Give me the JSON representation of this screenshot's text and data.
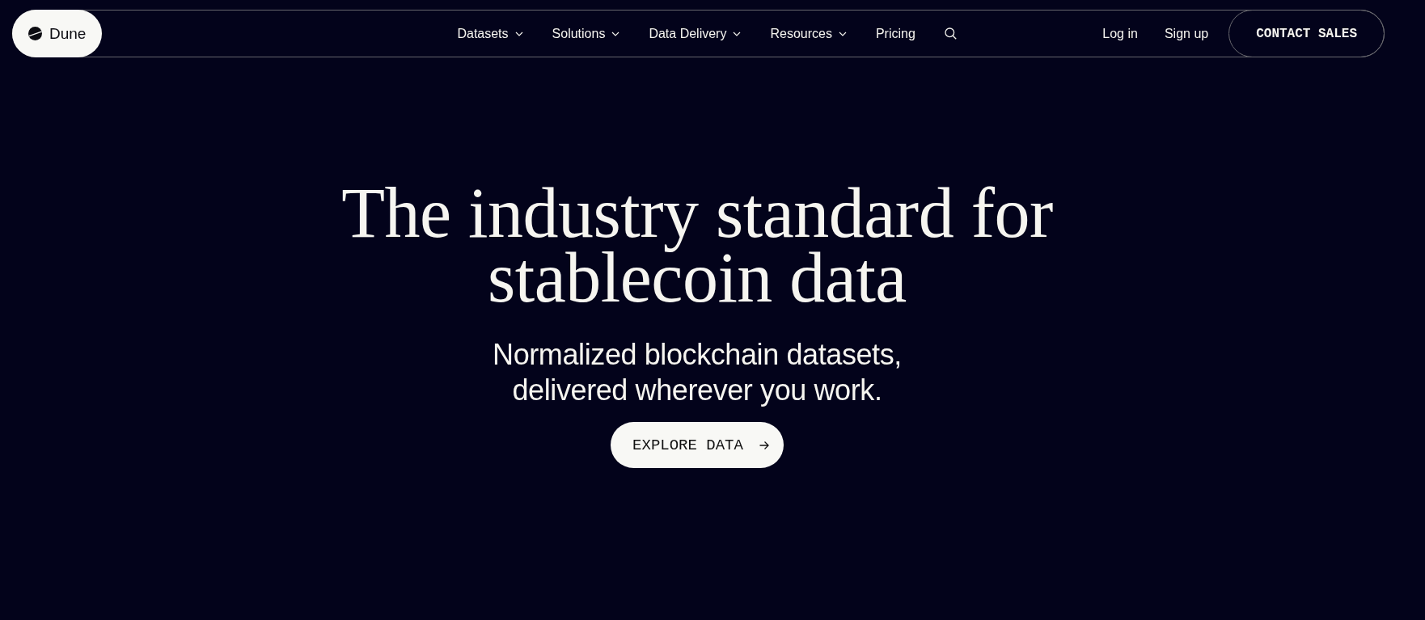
{
  "header": {
    "logo": {
      "label": "Dune"
    },
    "nav_items": [
      {
        "label": "Datasets",
        "kind": "dropdown"
      },
      {
        "label": "Solutions",
        "kind": "dropdown"
      },
      {
        "label": "Data Delivery",
        "kind": "dropdown"
      },
      {
        "label": "Resources",
        "kind": "dropdown"
      },
      {
        "label": "Pricing",
        "kind": "link"
      }
    ],
    "account_links": [
      {
        "label": "Log in"
      },
      {
        "label": "Sign up"
      }
    ],
    "cta_button": {
      "label": "CONTACT SALES"
    }
  },
  "hero": {
    "title_lines": [
      "The industry standard for",
      "stablecoin data"
    ],
    "subtitle_lines": [
      "Normalized blockchain datasets,",
      "delivered wherever you work."
    ],
    "button": {
      "label": "EXPLORE DATA"
    }
  }
}
